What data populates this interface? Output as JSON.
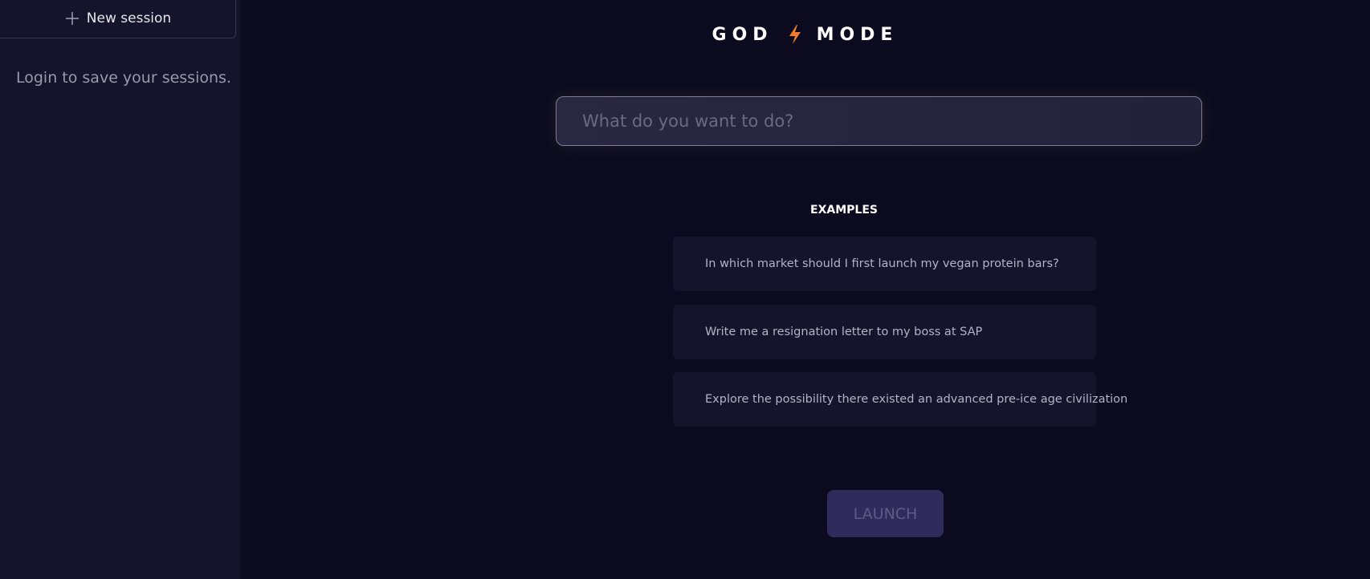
{
  "sidebar": {
    "new_session_label": "New session",
    "login_note": "Login to save your sessions."
  },
  "header": {
    "brand_left": "GOD",
    "brand_right": "MODE",
    "bolt_color": "#f07c2c"
  },
  "prompt": {
    "placeholder": "What do you want to do?",
    "value": ""
  },
  "examples": {
    "heading": "EXAMPLES",
    "items": [
      {
        "label": "In which market should I first launch my vegan protein bars?"
      },
      {
        "label": "Write me a resignation letter to my boss at SAP"
      },
      {
        "label": "Explore the possibility there existed an advanced pre-ice age civilization"
      }
    ]
  },
  "actions": {
    "launch_label": "LAUNCH"
  }
}
